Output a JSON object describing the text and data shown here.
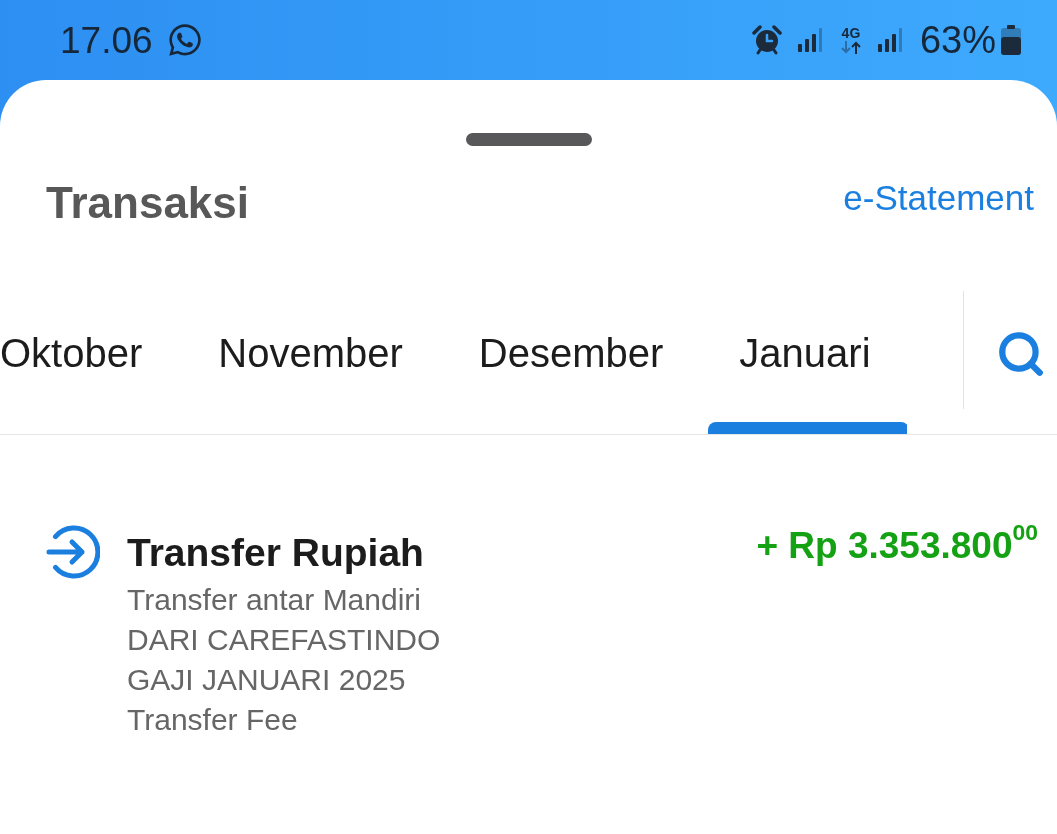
{
  "status_bar": {
    "time": "17.06",
    "network": "4G",
    "battery": "63%"
  },
  "header": {
    "title": "Transaksi",
    "link": "e-Statement"
  },
  "tabs": [
    {
      "label": "Oktober",
      "selected": false
    },
    {
      "label": "November",
      "selected": false
    },
    {
      "label": "Desember",
      "selected": false
    },
    {
      "label": "Januari",
      "selected": true
    }
  ],
  "transactions": [
    {
      "incoming": true,
      "title": "Transfer Rupiah",
      "amount": "+ Rp 3.353.800$^{00}$",
      "details": [
        "Transfer antar Mandiri",
        "DARI CAREFASTINDO",
        "GAJI JANUARI 2025",
        "Transfer Fee"
      ]
    }
  ]
}
